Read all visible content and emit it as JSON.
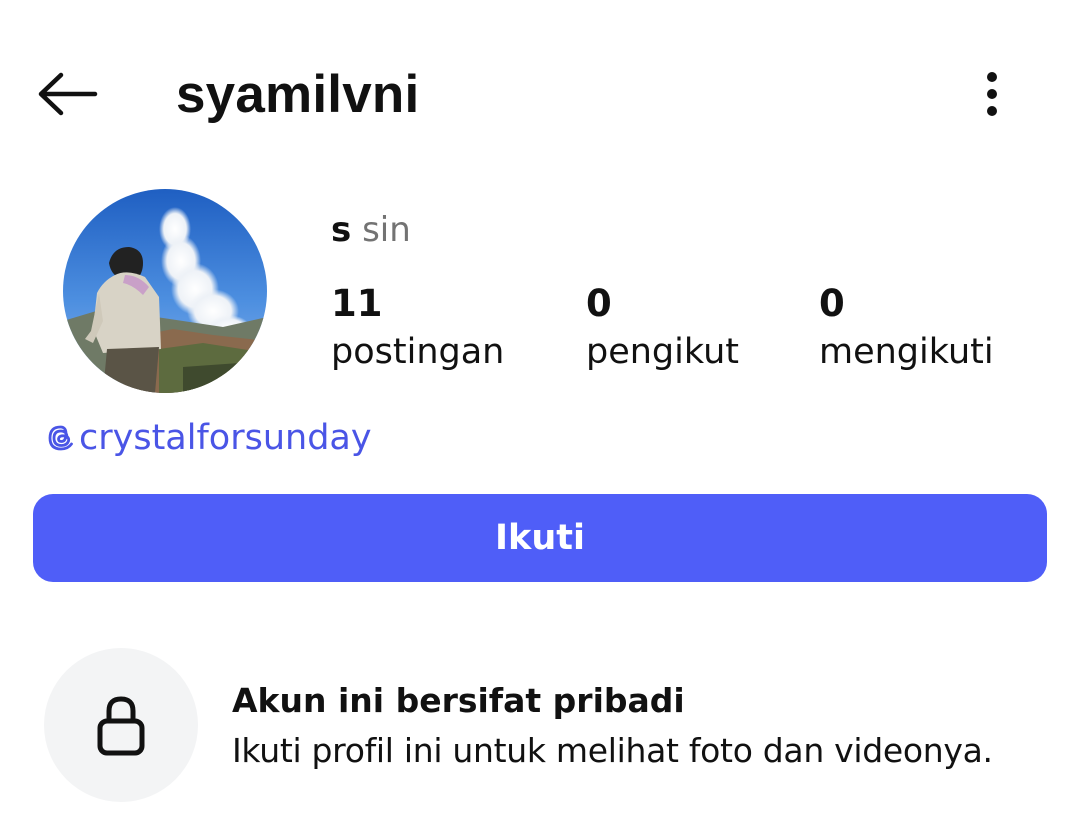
{
  "header": {
    "username": "syamilvni",
    "back_icon": "arrow-left-icon",
    "more_icon": "more-vertical-icon"
  },
  "profile": {
    "avatar_icon": "profile-photo",
    "name_first": "s",
    "name_rest": "sin",
    "stats": {
      "posts": {
        "count": "11",
        "label": "postingan"
      },
      "followers": {
        "count": "0",
        "label": "pengikut"
      },
      "following": {
        "count": "0",
        "label": "mengikuti"
      }
    },
    "threads": {
      "icon": "threads-icon",
      "handle": "crystalforsunday"
    }
  },
  "actions": {
    "follow_label": "Ikuti"
  },
  "private_notice": {
    "icon": "lock-icon",
    "title": "Akun ini bersifat pribadi",
    "description": "Ikuti profil ini untuk melihat foto dan videonya."
  },
  "colors": {
    "accent": "#4f5ef8",
    "link": "#4a55e6",
    "muted_text": "#737373",
    "lock_bg": "#f3f4f5"
  }
}
